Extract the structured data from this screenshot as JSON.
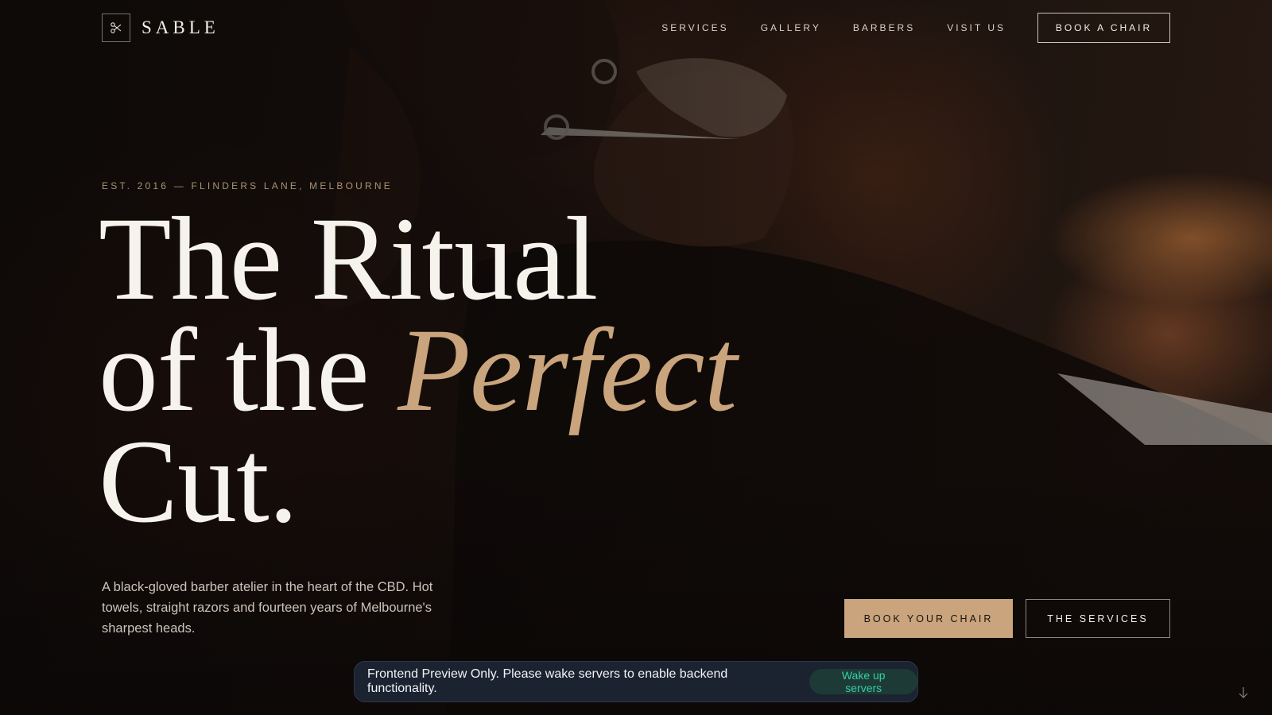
{
  "brand": {
    "name": "SABLE",
    "icon": "scissors-icon"
  },
  "nav": {
    "links": [
      "SERVICES",
      "GALLERY",
      "BARBERS",
      "VISIT US"
    ],
    "cta": "BOOK A CHAIR"
  },
  "hero": {
    "eyebrow": "EST. 2016 — FLINDERS LANE, MELBOURNE",
    "headline_line1": "The Ritual",
    "headline_line2": "of the ",
    "headline_accent": "Perfect",
    "headline_line3": "Cut.",
    "lede": "A black-gloved barber atelier in the heart of the CBD. Hot towels, straight razors and fourteen years of Melbourne's sharpest heads.",
    "primary_cta": "BOOK YOUR CHAIR",
    "secondary_cta": "THE SERVICES"
  },
  "toast": {
    "message": "Frontend Preview Only. Please wake servers to enable backend functionality.",
    "button": "Wake up servers"
  },
  "icons": {
    "scroll": "arrow-down-icon"
  },
  "colors": {
    "background": "#120d0a",
    "accent_gold": "#c9a47c",
    "text_light": "#f3efe8",
    "toast_bg": "#1b2331",
    "toast_button_text": "#34d1a3"
  }
}
